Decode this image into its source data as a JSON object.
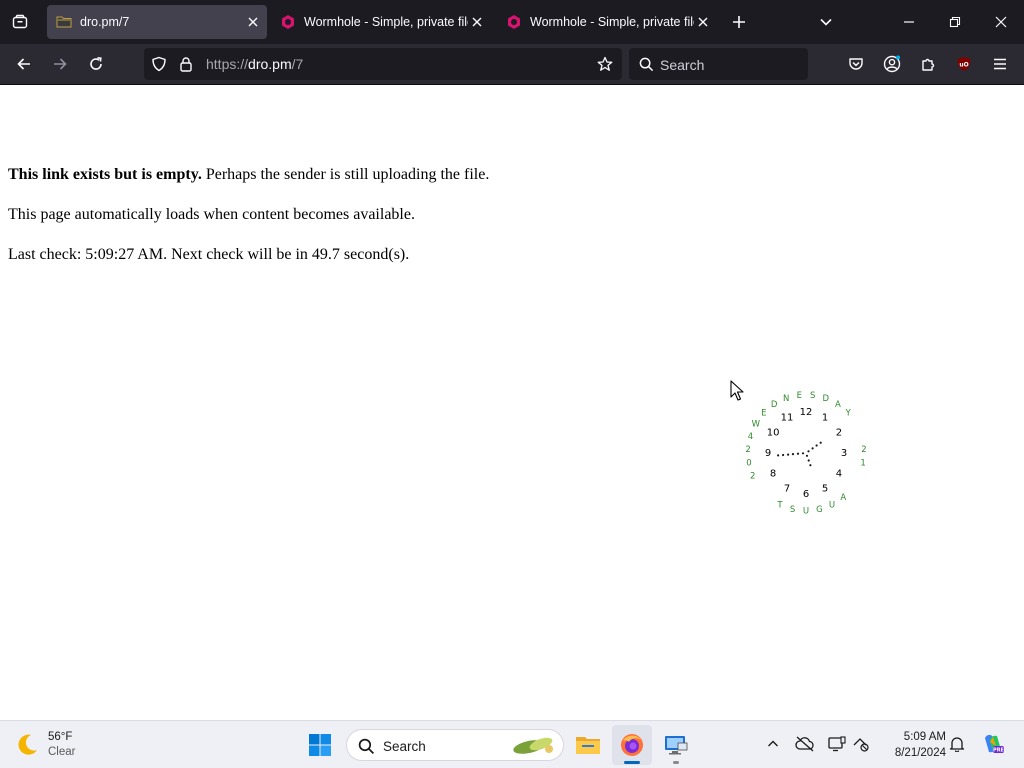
{
  "browser": {
    "tabs": [
      {
        "title": "dro.pm/7",
        "active": true
      },
      {
        "title": "Wormhole - Simple, private file",
        "active": false
      },
      {
        "title": "Wormhole - Simple, private file",
        "active": false
      }
    ],
    "url": {
      "scheme": "https://",
      "host": "dro.pm",
      "path": "/7"
    },
    "search_placeholder": "Search"
  },
  "page": {
    "line1_bold": "This link exists but is empty.",
    "line1_rest": " Perhaps the sender is still uploading the file.",
    "line2": "This page automatically loads when content becomes available.",
    "line3": "Last check: 5:09:27 AM. Next check will be in 49.7 second(s)."
  },
  "clock_widget": {
    "numbers": [
      "12",
      "1",
      "2",
      "3",
      "4",
      "5",
      "6",
      "7",
      "8",
      "9",
      "10",
      "11"
    ],
    "day_text": "WEDNESDAY",
    "date_text": "21 AUGUST 2024",
    "colors": {
      "numbers": "#000000",
      "ring": "#2e8b2e",
      "hands": "#1a1a1a"
    }
  },
  "taskbar": {
    "weather": {
      "temp": "56°F",
      "condition": "Clear"
    },
    "search_placeholder": "Search",
    "time": "5:09 AM",
    "date": "8/21/2024"
  },
  "colors": {
    "tabbar_bg": "#1c1b22",
    "toolbar_bg": "#2b2a33",
    "active_tab_bg": "#42414d",
    "wormhole_icon": "#d6136e",
    "taskbar_bg": "#eef0f5",
    "accent": "#0067c0"
  },
  "icons": {
    "tab_list": "tab-list-icon",
    "close": "close-icon",
    "new_tab": "plus-icon",
    "list_all_tabs": "chevron-down-icon",
    "minimize": "minimize-icon",
    "restore": "restore-icon",
    "window_close": "window-close-icon",
    "back": "back-arrow-icon",
    "forward": "forward-arrow-icon",
    "reload": "reload-icon",
    "tracking_protection": "shield-icon",
    "secure": "lock-icon",
    "bookmark": "star-icon",
    "search": "search-icon",
    "pocket": "pocket-icon",
    "account": "account-icon",
    "extensions": "puzzle-icon",
    "ublock": "ublock-origin-icon",
    "menu": "hamburger-menu-icon",
    "weather": "moon-icon",
    "start": "windows-start-icon",
    "file_explorer": "folder-icon",
    "firefox": "firefox-icon",
    "remote_desktop": "remote-desktop-icon",
    "tray_overflow": "chevron-up-icon",
    "onedrive": "cloud-off-icon",
    "display": "display-icon",
    "network": "network-icon",
    "notifications": "bell-icon",
    "copilot": "copilot-icon"
  }
}
